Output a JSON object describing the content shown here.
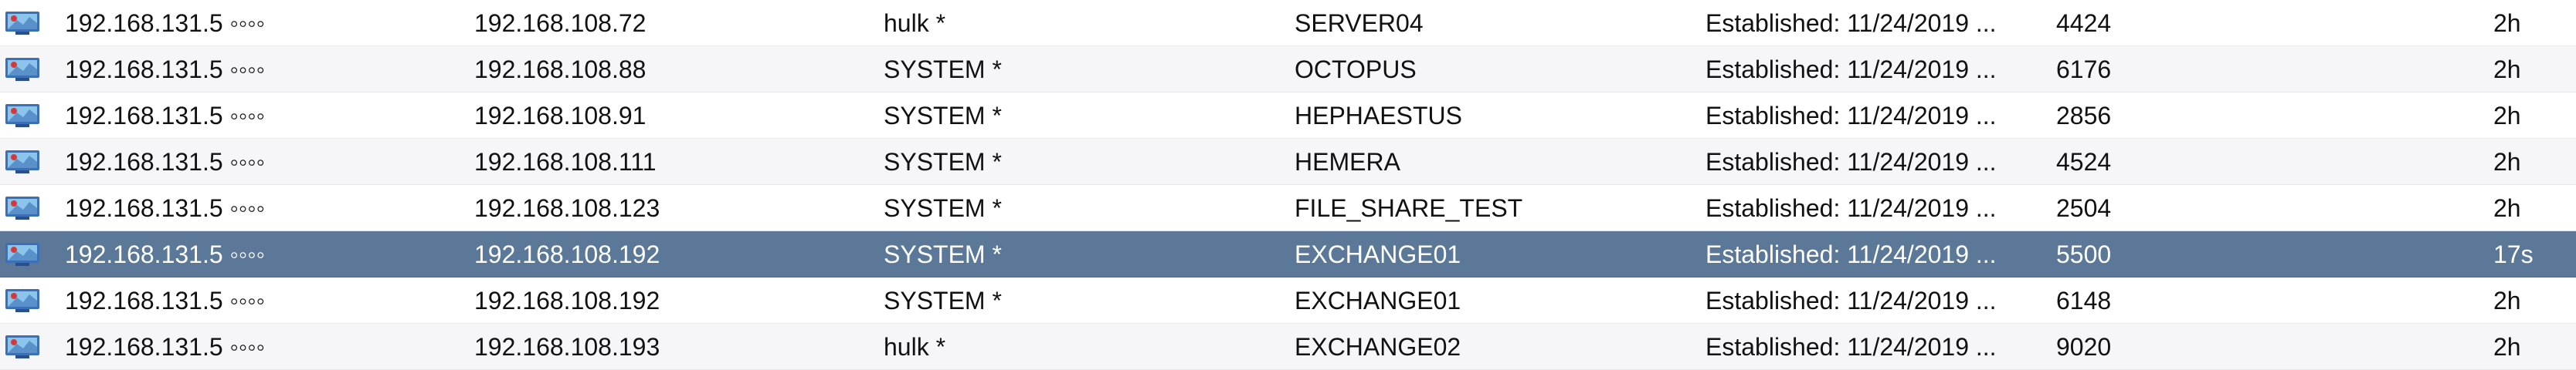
{
  "connections": {
    "rows": [
      {
        "local": "192.168.131.5 ◦◦◦◦",
        "remote": "192.168.108.72",
        "user": "hulk *",
        "host": "SERVER04",
        "state": "Established: 11/24/2019 ...",
        "pid": "4424",
        "age": "2h",
        "selected": false
      },
      {
        "local": "192.168.131.5 ◦◦◦◦",
        "remote": "192.168.108.88",
        "user": "SYSTEM *",
        "host": "OCTOPUS",
        "state": "Established: 11/24/2019 ...",
        "pid": "6176",
        "age": "2h",
        "selected": false
      },
      {
        "local": "192.168.131.5 ◦◦◦◦",
        "remote": "192.168.108.91",
        "user": "SYSTEM *",
        "host": "HEPHAESTUS",
        "state": "Established: 11/24/2019 ...",
        "pid": "2856",
        "age": "2h",
        "selected": false
      },
      {
        "local": "192.168.131.5 ◦◦◦◦",
        "remote": "192.168.108.111",
        "user": "SYSTEM *",
        "host": "HEMERA",
        "state": "Established: 11/24/2019 ...",
        "pid": "4524",
        "age": "2h",
        "selected": false
      },
      {
        "local": "192.168.131.5 ◦◦◦◦",
        "remote": "192.168.108.123",
        "user": "SYSTEM *",
        "host": "FILE_SHARE_TEST",
        "state": "Established: 11/24/2019 ...",
        "pid": "2504",
        "age": "2h",
        "selected": false
      },
      {
        "local": "192.168.131.5 ◦◦◦◦",
        "remote": "192.168.108.192",
        "user": "SYSTEM *",
        "host": "EXCHANGE01",
        "state": "Established: 11/24/2019 ...",
        "pid": "5500",
        "age": "17s",
        "selected": true
      },
      {
        "local": "192.168.131.5 ◦◦◦◦",
        "remote": "192.168.108.192",
        "user": "SYSTEM *",
        "host": "EXCHANGE01",
        "state": "Established: 11/24/2019 ...",
        "pid": "6148",
        "age": "2h",
        "selected": false
      },
      {
        "local": "192.168.131.5 ◦◦◦◦",
        "remote": "192.168.108.193",
        "user": "hulk *",
        "host": "EXCHANGE02",
        "state": "Established: 11/24/2019 ...",
        "pid": "9020",
        "age": "2h",
        "selected": false
      }
    ]
  },
  "icon": {
    "name": "network-session-icon",
    "colors": {
      "frame": "#3b6fb6",
      "screen": "#8cc4ec",
      "accent": "#d23a3a",
      "base": "#2a4f8a"
    }
  },
  "colors": {
    "selected_row": "#5c7898",
    "alt_row": "#f6f6f8",
    "text": "#111111",
    "selected_text": "#ffffff"
  }
}
